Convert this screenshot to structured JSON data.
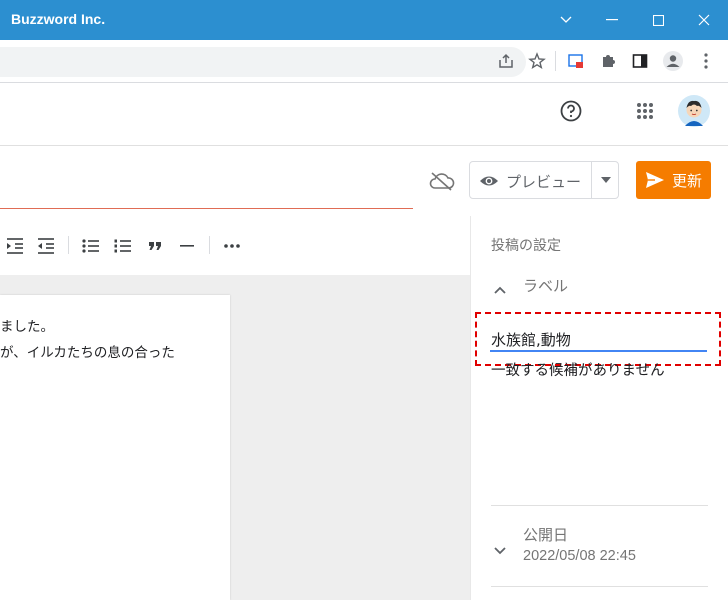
{
  "window": {
    "title": "Buzzword Inc."
  },
  "header": {
    "help_icon": "help-circle-icon",
    "apps_icon": "apps-grid-icon",
    "avatar_icon": "avatar"
  },
  "post": {
    "preview_label": "プレビュー",
    "update_label": "更新",
    "body_lines": [
      "ました。",
      "が、イルカたちの息の合った"
    ]
  },
  "sidebar": {
    "heading": "投稿の設定",
    "labels_section": {
      "title": "ラベル",
      "input_value": "水族館,動物",
      "suggestion_text": "一致する候補がありません"
    },
    "publish_section": {
      "title": "公開日",
      "value": "2022/05/08 22:45"
    }
  },
  "colors": {
    "titlebar": "#2c8fd0",
    "update_button": "#f57c00",
    "focus_underline": "#4285f4",
    "highlight_box": "#e00000"
  }
}
